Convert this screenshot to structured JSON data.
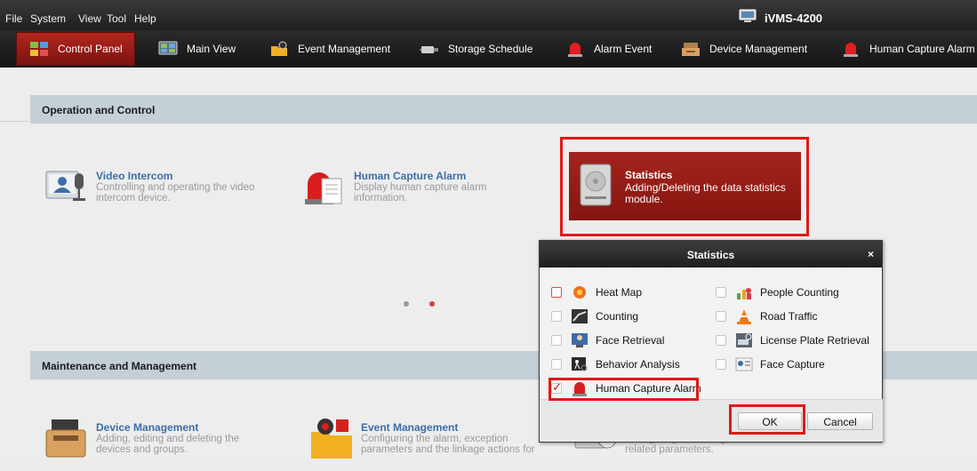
{
  "menu": [
    "File",
    "System",
    "View",
    "Tool",
    "Help"
  ],
  "app_title": "iVMS-4200",
  "tabs": [
    {
      "label": "Control Panel",
      "icon": "control-panel-icon"
    },
    {
      "label": "Main View",
      "icon": "main-view-icon"
    },
    {
      "label": "Event Management",
      "icon": "event-management-icon"
    },
    {
      "label": "Storage Schedule",
      "icon": "storage-schedule-icon"
    },
    {
      "label": "Alarm Event",
      "icon": "alarm-event-icon"
    },
    {
      "label": "Device Management",
      "icon": "device-management-icon"
    },
    {
      "label": "Human Capture Alarm",
      "icon": "alarm-light-icon"
    }
  ],
  "sections": {
    "operation": "Operation and Control",
    "maintenance": "Maintenance and Management"
  },
  "operation_items": [
    {
      "title": "Video Intercom",
      "desc": "Controlling and operating the video intercom device."
    },
    {
      "title": "Human Capture Alarm",
      "desc": "Display human capture alarm information."
    },
    {
      "title": "Statistics",
      "desc": "Adding/Deleting the data statistics module."
    }
  ],
  "maintenance_items": [
    {
      "title": "Device Management",
      "desc": "Adding, editing and deleting the devices and groups."
    },
    {
      "title": "Event Management",
      "desc": "Configuring the alarm, exception parameters and the linkage actions for"
    },
    {
      "title": "",
      "desc": "Configuring the storage schedules and related parameters."
    }
  ],
  "dialog": {
    "title": "Statistics",
    "close": "×",
    "options_left": [
      {
        "label": "Heat Map",
        "checked": false
      },
      {
        "label": "Counting",
        "checked": false
      },
      {
        "label": "Face Retrieval",
        "checked": false
      },
      {
        "label": "Behavior Analysis",
        "checked": false
      },
      {
        "label": "Human Capture Alarm",
        "checked": true
      }
    ],
    "options_right": [
      {
        "label": "People Counting",
        "checked": false
      },
      {
        "label": "Road Traffic",
        "checked": false
      },
      {
        "label": "License Plate Retrieval",
        "checked": false
      },
      {
        "label": "Face Capture",
        "checked": false
      }
    ],
    "ok": "OK",
    "cancel": "Cancel"
  },
  "colors": {
    "accent_red": "#a3241f",
    "highlight_outline": "#e01818",
    "section_header": "#c4cfd6",
    "link_blue": "#3c6ea8"
  }
}
